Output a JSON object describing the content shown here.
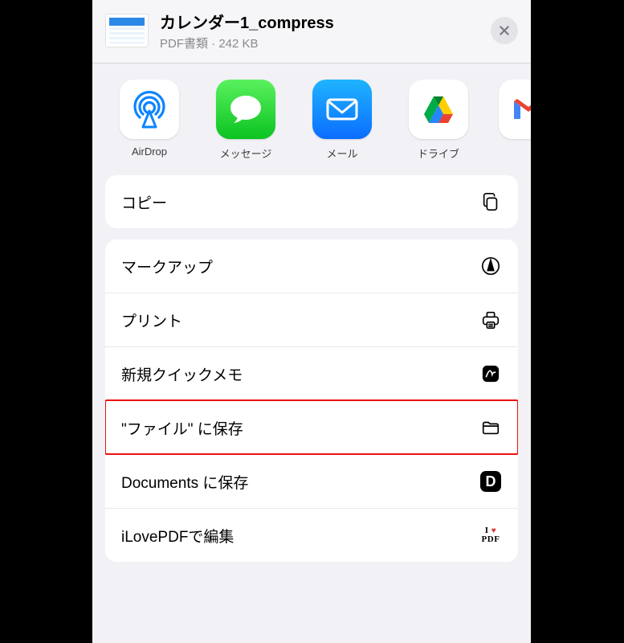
{
  "header": {
    "title": "カレンダー1_compress",
    "subtitle": "PDF書類 · 242 KB"
  },
  "apps": [
    {
      "id": "airdrop",
      "label": "AirDrop"
    },
    {
      "id": "messages",
      "label": "メッセージ"
    },
    {
      "id": "mail",
      "label": "メール"
    },
    {
      "id": "drive",
      "label": "ドライブ"
    },
    {
      "id": "gmail",
      "label": ""
    }
  ],
  "actions": {
    "copy": "コピー",
    "markup": "マークアップ",
    "print": "プリント",
    "quicknote": "新規クイックメモ",
    "savefiles": "\"ファイル\" に保存",
    "documents": "Documents に保存",
    "ilovepdf": "iLovePDFで編集"
  }
}
